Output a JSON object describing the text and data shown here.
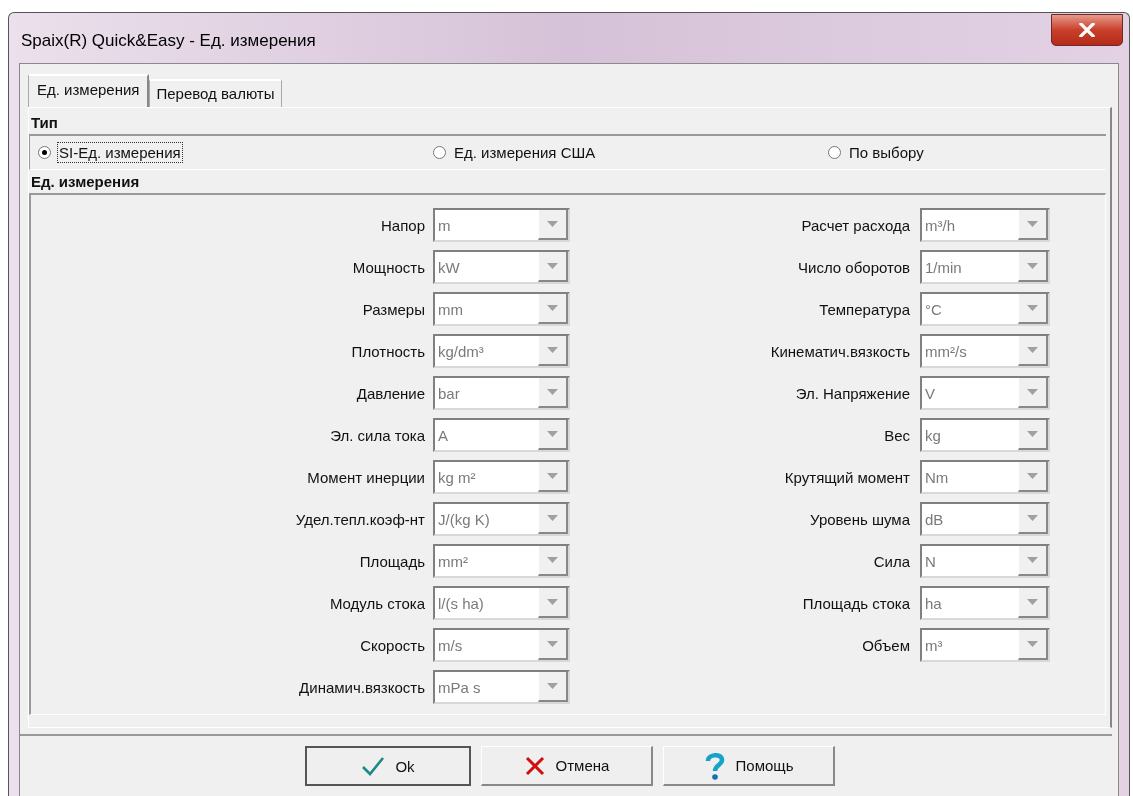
{
  "window": {
    "title": "Spaix(R) Quick&Easy - Ед. измерения"
  },
  "tabs": [
    {
      "label": "Ед. измерения",
      "selected": true
    },
    {
      "label": "Перевод валюты",
      "selected": false
    }
  ],
  "type_group": {
    "title": "Тип",
    "options": [
      {
        "label": "SI-Ед. измерения",
        "selected": true
      },
      {
        "label": "Ед. измерения США",
        "selected": false
      },
      {
        "label": "По выбору",
        "selected": false
      }
    ]
  },
  "units_group": {
    "title": "Ед. измерения",
    "left": [
      {
        "label": "Напор",
        "value": "m",
        "disabled": true
      },
      {
        "label": "Мощность",
        "value": "kW",
        "disabled": true
      },
      {
        "label": "Размеры",
        "value": "mm",
        "disabled": true
      },
      {
        "label": "Плотность",
        "value": "kg/dm³",
        "disabled": true
      },
      {
        "label": "Давление",
        "value": "bar",
        "disabled": true
      },
      {
        "label": "Эл. сила тока",
        "value": "A",
        "disabled": true
      },
      {
        "label": "Момент инерции",
        "value": "kg m²",
        "disabled": true
      },
      {
        "label": "Удел.тепл.коэф-нт",
        "value": "J/(kg K)",
        "disabled": true
      },
      {
        "label": "Площадь",
        "value": "mm²",
        "disabled": true
      },
      {
        "label": "Модуль стока",
        "value": "l/(s ha)",
        "disabled": true
      },
      {
        "label": "Скорость",
        "value": "m/s",
        "disabled": true
      },
      {
        "label": "Динамич.вязкость",
        "value": "mPa s",
        "disabled": true
      }
    ],
    "right": [
      {
        "label": "Расчет расхода",
        "value": "m³/h",
        "disabled": true
      },
      {
        "label": "Число оборотов",
        "value": "1/min",
        "disabled": true
      },
      {
        "label": "Температура",
        "value": "°C",
        "disabled": true
      },
      {
        "label": "Кинематич.вязкость",
        "value": "mm²/s",
        "disabled": true
      },
      {
        "label": "Эл. Напряжение",
        "value": "V",
        "disabled": true
      },
      {
        "label": "Вес",
        "value": "kg",
        "disabled": true
      },
      {
        "label": "Крутящий момент",
        "value": "Nm",
        "disabled": true
      },
      {
        "label": "Уровень шума",
        "value": "dB",
        "disabled": true
      },
      {
        "label": "Сила",
        "value": "N",
        "disabled": true
      },
      {
        "label": "Площадь стока",
        "value": "ha",
        "disabled": true
      },
      {
        "label": "Объем",
        "value": "m³",
        "disabled": true
      }
    ]
  },
  "buttons": [
    {
      "kind": "ok",
      "label": "Ok",
      "focused": true
    },
    {
      "kind": "cancel",
      "label": "Отмена",
      "focused": false
    },
    {
      "kind": "help",
      "label": "Помощь",
      "focused": false
    }
  ]
}
